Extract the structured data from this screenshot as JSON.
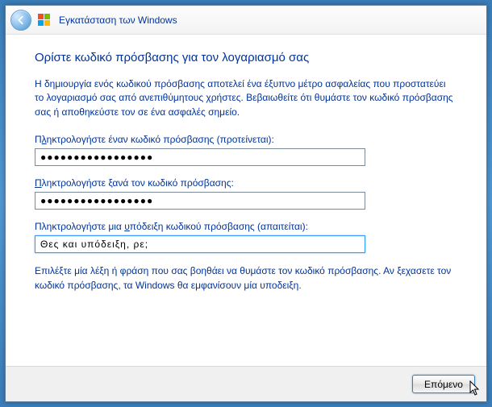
{
  "titlebar": {
    "title": "Εγκατάσταση των Windows"
  },
  "main": {
    "heading": "Ορίστε κωδικό πρόσβασης για τον λογαριασμό σας",
    "description": "Η δημιουργία ενός κωδικού πρόσβασης αποτελεί ένα έξυπνο μέτρο ασφαλείας που προστατεύει το λογαριασμό σας από ανεπιθύμητους χρήστες. Βεβαιωθείτε ότι θυμάστε τον κωδικό πρόσβασης σας ή αποθηκεύστε τον σε ένα ασφαλές σημείο.",
    "password": {
      "label_pre": "Π",
      "label_underline": "λ",
      "label_post": "ηκτρολογήστε έναν κωδικό πρόσβασης (προτείνεται):",
      "value": "●●●●●●●●●●●●●●●●●"
    },
    "confirm": {
      "label_pre": "",
      "label_underline": "Π",
      "label_post": "ληκτρολογήστε ξανά τον κωδικό πρόσβασης:",
      "value": "●●●●●●●●●●●●●●●●●"
    },
    "hint": {
      "label_pre": "Πληκτρολογήστε μια ",
      "label_underline": "υ",
      "label_post": "πόδειξη κωδικού πρόσβασης (απαιτείται):",
      "value": "Θες και υπόδειξη, ρε;"
    },
    "help": "Επιλέξτε μία λέξη ή φράση που σας βοηθάει να θυμάστε τον κωδικό πρόσβασης. Αν ξεχασετε τον κωδικό πρόσβασης, τα Windows θα εμφανίσουν μία υποδειξη."
  },
  "footer": {
    "next_label": "Επόμενο"
  }
}
